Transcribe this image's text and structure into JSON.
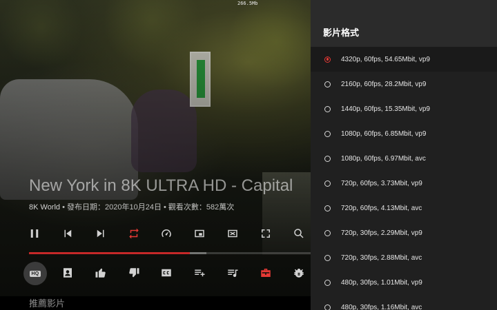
{
  "status": {
    "data_rate": "266.5Mb"
  },
  "video": {
    "title": "New York in 8K ULTRA HD - Capital",
    "channel": "8K World",
    "meta": " • 發布日期：2020年10月24日 • 觀看次數：582萬次",
    "progress": 0.57,
    "buffered": 0.63
  },
  "controls_row1": [
    {
      "name": "pause-icon",
      "color": "#d2d2d2"
    },
    {
      "name": "skip-previous-icon",
      "color": "#d2d2d2"
    },
    {
      "name": "skip-next-icon",
      "color": "#d2d2d2"
    },
    {
      "name": "repeat-icon",
      "color": "#e53935"
    },
    {
      "name": "speed-icon",
      "color": "#d2d2d2"
    },
    {
      "name": "picture-in-picture-icon",
      "color": "#d2d2d2"
    },
    {
      "name": "close-box-icon",
      "color": "#d2d2d2"
    },
    {
      "name": "fullscreen-icon",
      "color": "#d2d2d2"
    },
    {
      "name": "search-icon",
      "color": "#d2d2d2"
    }
  ],
  "controls_row2": {
    "hq_label": "HQ",
    "icons": [
      {
        "name": "channel-account-icon",
        "color": "#d2d2d2"
      },
      {
        "name": "like-icon",
        "color": "#d2d2d2"
      },
      {
        "name": "dislike-icon",
        "color": "#d2d2d2"
      },
      {
        "name": "subtitles-icon",
        "color": "#d2d2d2"
      },
      {
        "name": "add-to-playlist-icon",
        "color": "#d2d2d2"
      },
      {
        "name": "playlist-music-icon",
        "color": "#d2d2d2"
      },
      {
        "name": "subscribe-toolbox-icon",
        "color": "#e53935"
      },
      {
        "name": "bug-report-icon",
        "color": "#d2d2d2"
      }
    ]
  },
  "recommendations_label": "推薦影片",
  "panel": {
    "title": "影片格式",
    "selected_index": 0,
    "formats": [
      "4320p, 60fps, 54.65Mbit, vp9",
      "2160p, 60fps, 28.2Mbit, vp9",
      "1440p, 60fps, 15.35Mbit, vp9",
      "1080p, 60fps, 6.85Mbit, vp9",
      "1080p, 60fps, 6.97Mbit, avc",
      "720p, 60fps, 3.73Mbit, vp9",
      "720p, 60fps, 4.13Mbit, avc",
      "720p, 30fps, 2.29Mbit, vp9",
      "720p, 30fps, 2.88Mbit, avc",
      "480p, 30fps, 1.01Mbit, vp9",
      "480p, 30fps, 1.16Mbit, avc"
    ]
  },
  "colors": {
    "accent": "#e53935",
    "panel_bg": "#202020",
    "panel_header_bg": "#2b2b2b"
  }
}
